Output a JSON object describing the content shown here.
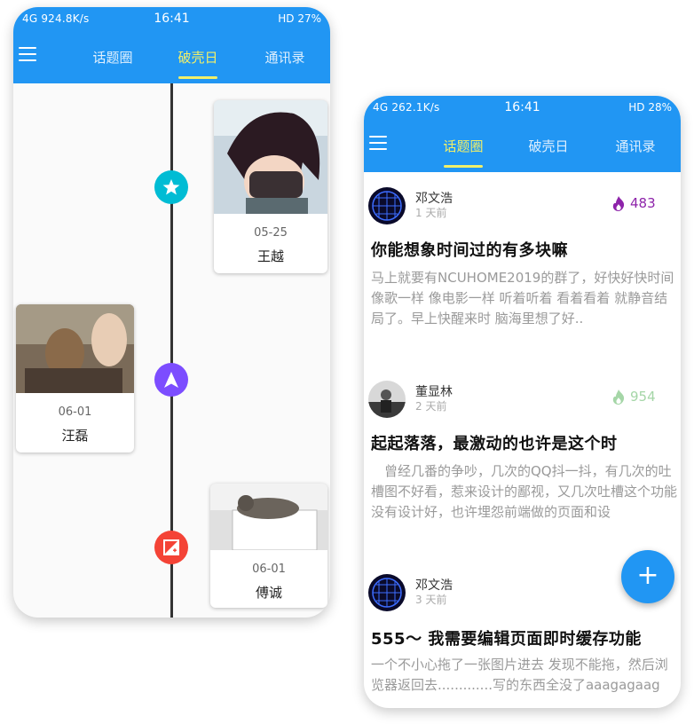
{
  "left_screen": {
    "status": {
      "left": "4G 924.8K/s",
      "time": "16:41",
      "right": "HD 27%"
    },
    "tabs": [
      "话题圈",
      "破壳日",
      "通讯录"
    ],
    "active_tab": 1,
    "timeline": [
      {
        "date": "05-25",
        "name": "王越",
        "node_icon": "star-icon",
        "node_color": "#00bcd4"
      },
      {
        "date": "06-01",
        "name": "汪磊",
        "node_icon": "navigation-arrow-icon",
        "node_color": "#7c4dff"
      },
      {
        "date": "06-01",
        "name": "傅诚",
        "node_icon": "image-edit-icon",
        "node_color": "#f44336"
      }
    ]
  },
  "right_screen": {
    "status": {
      "left": "4G 262.1K/s",
      "time": "16:41",
      "right": "HD 28%"
    },
    "tabs": [
      "话题圈",
      "破壳日",
      "通讯录"
    ],
    "active_tab": 0,
    "posts": [
      {
        "author": "邓文浩",
        "time": "1 天前",
        "heat": "483",
        "heat_color": "#8e24aa",
        "title": "你能想象时间过的有多块嘛",
        "body": "马上就要有NCUHOME2019的群了，好快好快时间像歌一样 像电影一样 听着听着 看着看着 就静音结局了。早上快醒来时 脑海里想了好.."
      },
      {
        "author": "董显林",
        "time": "2 天前",
        "heat": "954",
        "heat_color": "#a5d6a7",
        "title": "起起落落，最激动的也许是这个时",
        "body": "　曾经几番的争吵，几次的QQ抖一抖，有几次的吐槽图不好看，惹来设计的鄙视，又几次吐槽这个功能没有设计好，也许埋怨前端做的页面和设"
      },
      {
        "author": "邓文浩",
        "time": "3 天前",
        "heat": "",
        "heat_color": "#8e24aa",
        "title": "555～ 我需要编辑页面即时缓存功能",
        "body": "一个不小心拖了一张图片进去 发现不能拖，然后浏览器返回去.............写的东西全没了aaagagaag"
      }
    ],
    "fab_label": "+"
  }
}
